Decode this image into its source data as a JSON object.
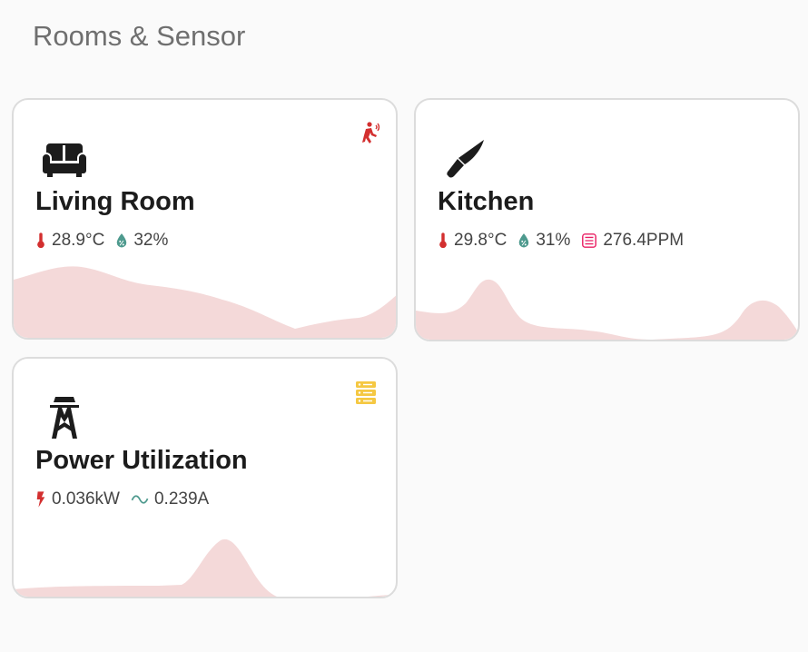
{
  "section": {
    "title": "Rooms & Sensor"
  },
  "cards": [
    {
      "name": "Living Room",
      "icon": "sofa-icon",
      "badge": "motion-sensor-icon",
      "sensors": [
        {
          "icon": "thermometer-icon",
          "value": "28.9°C",
          "color": "#d32f2f"
        },
        {
          "icon": "water-percent-icon",
          "value": "32%",
          "color": "#4e9a8e"
        }
      ]
    },
    {
      "name": "Kitchen",
      "icon": "knife-icon",
      "sensors": [
        {
          "icon": "thermometer-icon",
          "value": "29.8°C",
          "color": "#d32f2f"
        },
        {
          "icon": "water-percent-icon",
          "value": "31%",
          "color": "#4e9a8e"
        },
        {
          "icon": "air-filter-icon",
          "value": "276.4PPM",
          "color": "#e91e63"
        }
      ]
    },
    {
      "name": "Power Utilization",
      "icon": "transmission-tower-icon",
      "badge": "server-icon",
      "sensors": [
        {
          "icon": "flash-icon",
          "value": "0.036kW",
          "color": "#d32f2f"
        },
        {
          "icon": "current-ac-icon",
          "value": "0.239A",
          "color": "#4e9a8e"
        }
      ]
    }
  ],
  "colors": {
    "graph_fill": "#f4d9d9",
    "badge_red": "#d32f2f",
    "badge_yellow": "#f5c842"
  }
}
